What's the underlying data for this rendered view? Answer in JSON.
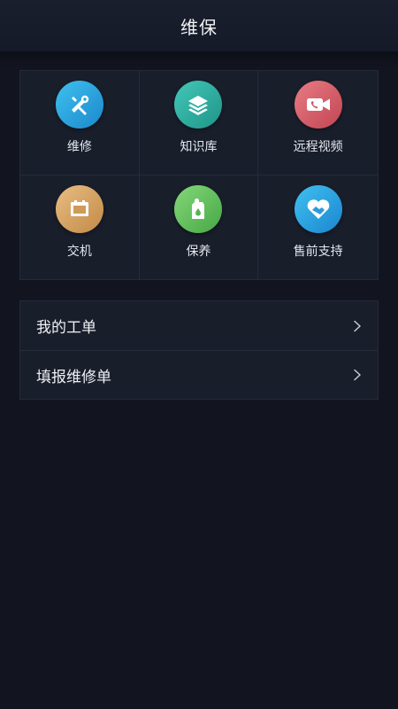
{
  "header": {
    "title": "维保"
  },
  "grid": [
    {
      "label": "维修",
      "icon": "wrench-screwdriver-icon",
      "color_from": "#37b9ea",
      "color_to": "#1e8fd0"
    },
    {
      "label": "知识库",
      "icon": "layers-icon",
      "color_from": "#3cc2b2",
      "color_to": "#239a8f"
    },
    {
      "label": "远程视频",
      "icon": "video-call-icon",
      "color_from": "#e0727a",
      "color_to": "#c54c58"
    },
    {
      "label": "交机",
      "icon": "battery-box-icon",
      "color_from": "#e2b478",
      "color_to": "#c8924f"
    },
    {
      "label": "保养",
      "icon": "oil-can-icon",
      "color_from": "#7cd273",
      "color_to": "#4fae4c"
    },
    {
      "label": "售前支持",
      "icon": "heart-handshake-icon",
      "color_from": "#3cb9ec",
      "color_to": "#1f8fd4"
    }
  ],
  "list": [
    {
      "label": "我的工单"
    },
    {
      "label": "填报维修单"
    }
  ]
}
